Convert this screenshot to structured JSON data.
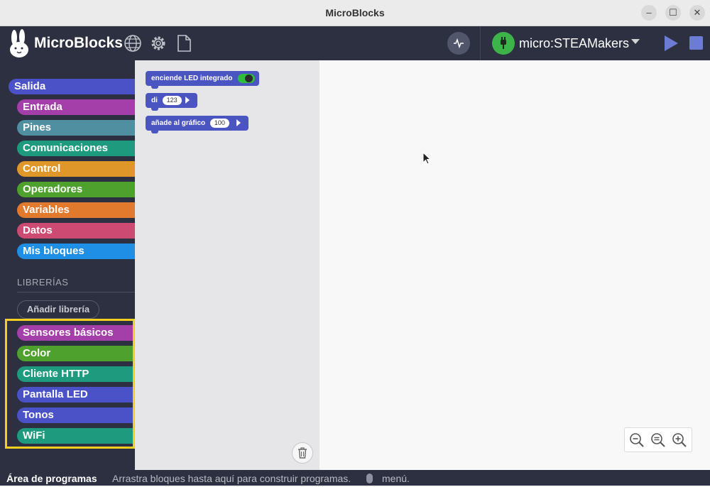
{
  "window": {
    "title": "MicroBlocks",
    "minimize": "–",
    "maximize": "☐",
    "close": "✕"
  },
  "toolbar": {
    "app_name": "MicroBlocks",
    "board_name": "micro:STEAMakers"
  },
  "colors": {
    "toolbar_bg": "#2d3040",
    "accent_run": "#6c7bd4",
    "board_connected": "#3cb44a",
    "library_highlight": "#f5cf1e"
  },
  "categories": [
    {
      "label": "Salida",
      "color": "#4b52c8"
    },
    {
      "label": "Entrada",
      "color": "#a43ea8"
    },
    {
      "label": "Pines",
      "color": "#4f8fa0"
    },
    {
      "label": "Comunicaciones",
      "color": "#1e9a7e"
    },
    {
      "label": "Control",
      "color": "#e0972a"
    },
    {
      "label": "Operadores",
      "color": "#4fa12d"
    },
    {
      "label": "Variables",
      "color": "#e27a2e"
    },
    {
      "label": "Datos",
      "color": "#cd4a72"
    },
    {
      "label": "Mis bloques",
      "color": "#1f8fe6"
    }
  ],
  "libraries": {
    "heading": "LIBRERÍAS",
    "add_button": "Añadir librería",
    "items": [
      {
        "label": "Sensores básicos",
        "color": "#a43ea8"
      },
      {
        "label": "Color",
        "color": "#4fa12d"
      },
      {
        "label": "Cliente HTTP",
        "color": "#1e9a7e"
      },
      {
        "label": "Pantalla LED",
        "color": "#4b52c8"
      },
      {
        "label": "Tonos",
        "color": "#4b52c8"
      },
      {
        "label": "WiFi",
        "color": "#1e9a7e"
      }
    ]
  },
  "palette_blocks": [
    {
      "label": "enciende LED integrado",
      "toggle": true
    },
    {
      "label": "di",
      "value": "123"
    },
    {
      "label": "añade al gráfico",
      "value": "100"
    }
  ],
  "statusbar": {
    "title": "Área de programas",
    "hint": "Arrastra bloques hasta aquí para construir programas.",
    "menu": "menú."
  },
  "icons": [
    "globe-icon",
    "gear-icon",
    "file-icon",
    "graph-icon",
    "plug-icon",
    "chevron-down-icon",
    "play-icon",
    "stop-icon",
    "trash-icon",
    "zoom-out-icon",
    "zoom-reset-icon",
    "zoom-in-icon",
    "mouse-icon"
  ]
}
